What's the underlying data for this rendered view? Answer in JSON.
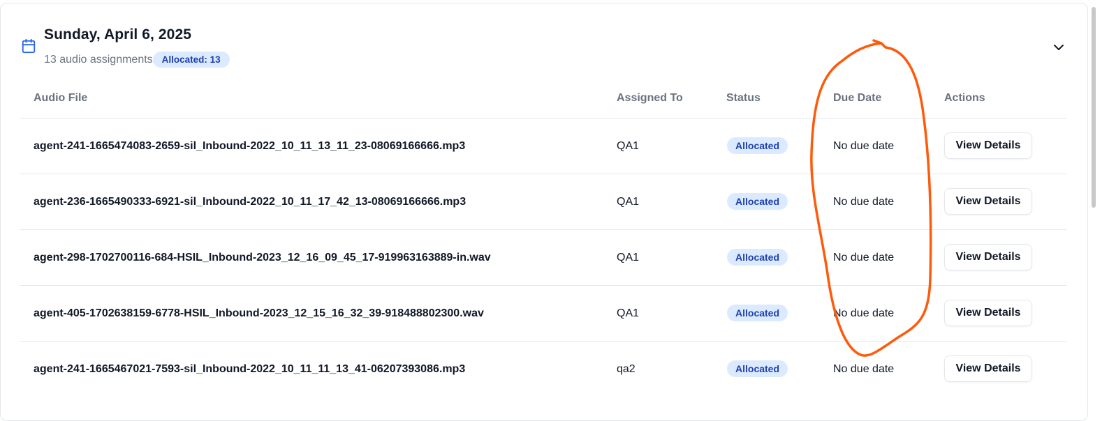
{
  "header": {
    "title": "Sunday, April 6, 2025",
    "subtitle": "13 audio assignments",
    "badge": "Allocated: 13"
  },
  "table": {
    "columns": [
      "Audio File",
      "Assigned To",
      "Status",
      "Due Date",
      "Actions"
    ],
    "rows": [
      {
        "file": "agent-241-1665474083-2659-sil_Inbound-2022_10_11_13_11_23-08069166666.mp3",
        "assigned": "QA1",
        "status": "Allocated",
        "due": "No due date",
        "action": "View Details"
      },
      {
        "file": "agent-236-1665490333-6921-sil_Inbound-2022_10_11_17_42_13-08069166666.mp3",
        "assigned": "QA1",
        "status": "Allocated",
        "due": "No due date",
        "action": "View Details"
      },
      {
        "file": "agent-298-1702700116-684-HSIL_Inbound-2023_12_16_09_45_17-919963163889-in.wav",
        "assigned": "QA1",
        "status": "Allocated",
        "due": "No due date",
        "action": "View Details"
      },
      {
        "file": "agent-405-1702638159-6778-HSIL_Inbound-2023_12_15_16_32_39-918488802300.wav",
        "assigned": "QA1",
        "status": "Allocated",
        "due": "No due date",
        "action": "View Details"
      },
      {
        "file": "agent-241-1665467021-7593-sil_Inbound-2022_10_11_11_13_41-06207393086.mp3",
        "assigned": "qa2",
        "status": "Allocated",
        "due": "No due date",
        "action": "View Details"
      }
    ]
  },
  "icons": {
    "calendar": "calendar-icon",
    "collapse": "chevron-down-icon"
  },
  "colors": {
    "accent": "#2563eb",
    "badge_bg": "#dbeafe",
    "badge_text": "#1e40af",
    "annotation": "#ff5a0a"
  }
}
